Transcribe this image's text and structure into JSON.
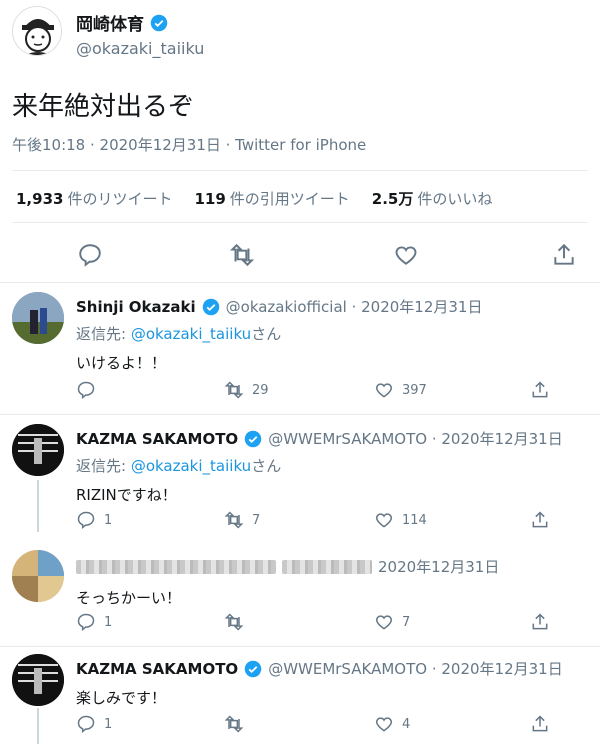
{
  "main": {
    "name": "岡崎体育",
    "handle": "@okazaki_taiiku",
    "text": "来年絶対出るぞ",
    "meta": "午後10:18 · 2020年12月31日 · Twitter for iPhone",
    "stats": {
      "retweets_num": "1,933",
      "retweets_label": "件のリツイート",
      "quotes_num": "119",
      "quotes_label": "件の引用ツイート",
      "likes_num": "2.5万",
      "likes_label": "件のいいね"
    },
    "icons": [
      "reply-icon",
      "retweet-icon",
      "like-icon",
      "share-icon"
    ]
  },
  "replies": [
    {
      "name": "Shinji Okazaki",
      "handle": "@okazakiofficial",
      "date": "· 2020年12月31日",
      "reply_prefix": "返信先: ",
      "reply_to": "@okazaki_taiiku",
      "reply_suffix": "さん",
      "text": "いけるよ！！",
      "reply_count": "",
      "retweet_count": "29",
      "like_count": "397"
    },
    {
      "name": "KAZMA SAKAMOTO",
      "handle": "@WWEMrSAKAMOTO",
      "date": "· 2020年12月31日",
      "reply_prefix": "返信先: ",
      "reply_to": "@okazaki_taiiku",
      "reply_suffix": "さん",
      "text": "RIZINですね！",
      "reply_count": "1",
      "retweet_count": "7",
      "like_count": "114"
    },
    {
      "name": "",
      "handle": "",
      "date": "2020年12月31日",
      "text": "そっちかーい！",
      "reply_count": "1",
      "retweet_count": "",
      "like_count": "7"
    },
    {
      "name": "KAZMA SAKAMOTO",
      "handle": "@WWEMrSAKAMOTO",
      "date": "· 2020年12月31日",
      "text": "楽しみです！",
      "reply_count": "1",
      "retweet_count": "",
      "like_count": "4"
    }
  ],
  "colors": {
    "link": "#1b95e0",
    "verified": "#1da1f2",
    "secondary": "#657786"
  }
}
